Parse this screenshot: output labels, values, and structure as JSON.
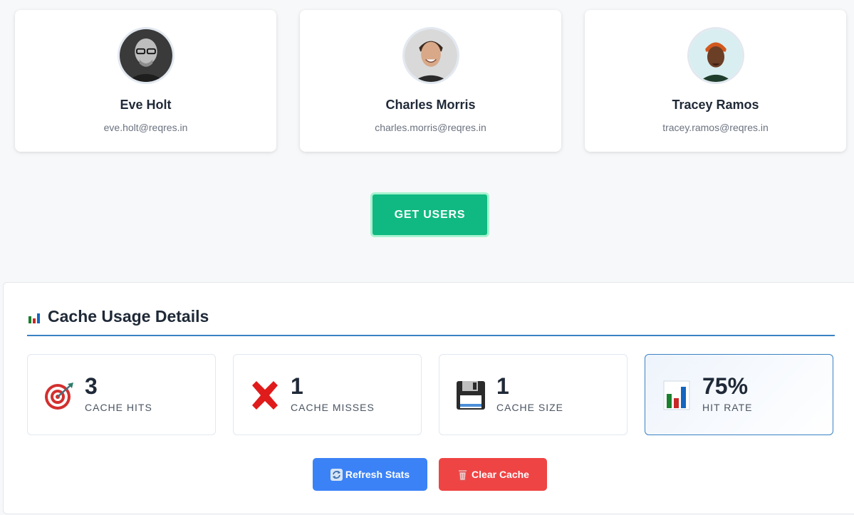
{
  "users": [
    {
      "name": "Eve Holt",
      "email": "eve.holt@reqres.in",
      "avatar_icon": "avatar-photo-icon"
    },
    {
      "name": "Charles Morris",
      "email": "charles.morris@reqres.in",
      "avatar_icon": "avatar-photo-icon"
    },
    {
      "name": "Tracey Ramos",
      "email": "tracey.ramos@reqres.in",
      "avatar_icon": "avatar-photo-icon"
    }
  ],
  "get_users_label": "GET USERS",
  "cache": {
    "title": "Cache Usage Details",
    "title_icon": "bar-chart-icon",
    "stats": [
      {
        "value": "3",
        "label": "Cache Hits",
        "icon": "target-icon"
      },
      {
        "value": "1",
        "label": "Cache Misses",
        "icon": "cross-icon"
      },
      {
        "value": "1",
        "label": "Cache Size",
        "icon": "floppy-disk-icon"
      },
      {
        "value": "75%",
        "label": "Hit Rate",
        "icon": "bar-chart-icon"
      }
    ],
    "refresh_label": "Refresh Stats",
    "clear_label": "Clear Cache"
  },
  "colors": {
    "get_users": "#10b981",
    "refresh": "#3b82f6",
    "clear": "#ef4444",
    "accent_rule": "#3b82c4"
  }
}
